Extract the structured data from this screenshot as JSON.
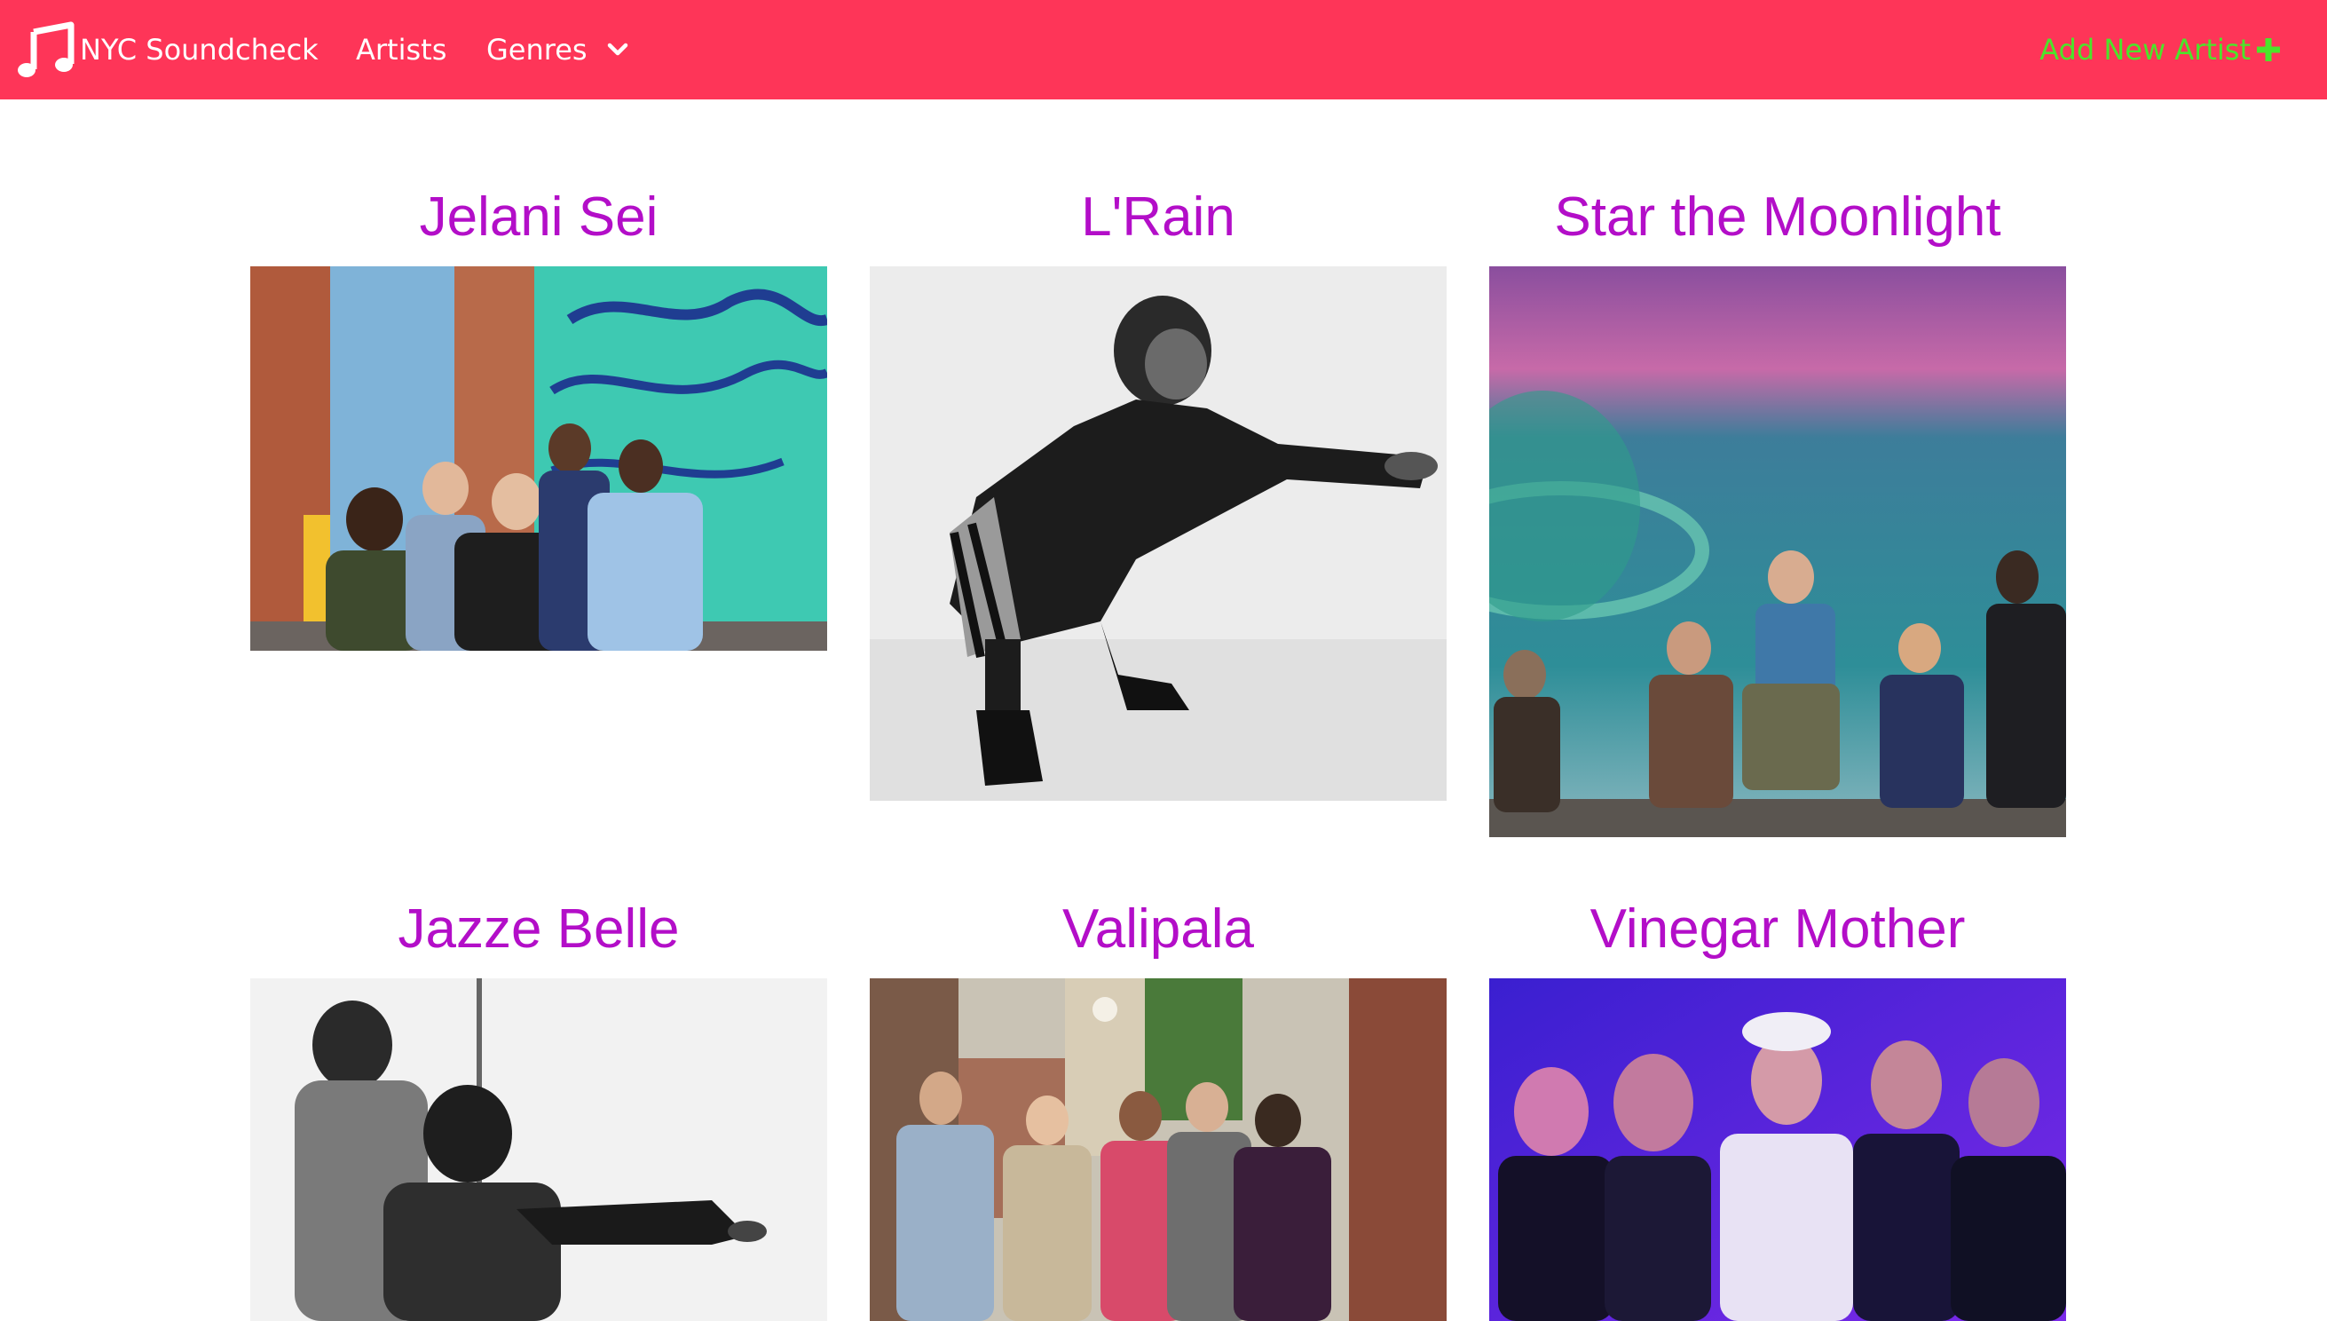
{
  "navbar": {
    "brand": "NYC Soundcheck",
    "links": [
      "Artists",
      "Genres"
    ],
    "add_artist": "Add New Artist",
    "colors": {
      "background": "#fe3558",
      "link": "#ffffff",
      "add": "#4be52a"
    }
  },
  "artists": [
    {
      "name": "Jelani Sei"
    },
    {
      "name": "L'Rain"
    },
    {
      "name": "Star the Moonlight"
    },
    {
      "name": "Jazze Belle"
    },
    {
      "name": "Valipala"
    },
    {
      "name": "Vinegar Mother"
    }
  ],
  "colors": {
    "artist_title": "#b30ec8"
  },
  "icons": [
    "music-note-icon",
    "chevron-down-icon",
    "plus-icon"
  ]
}
